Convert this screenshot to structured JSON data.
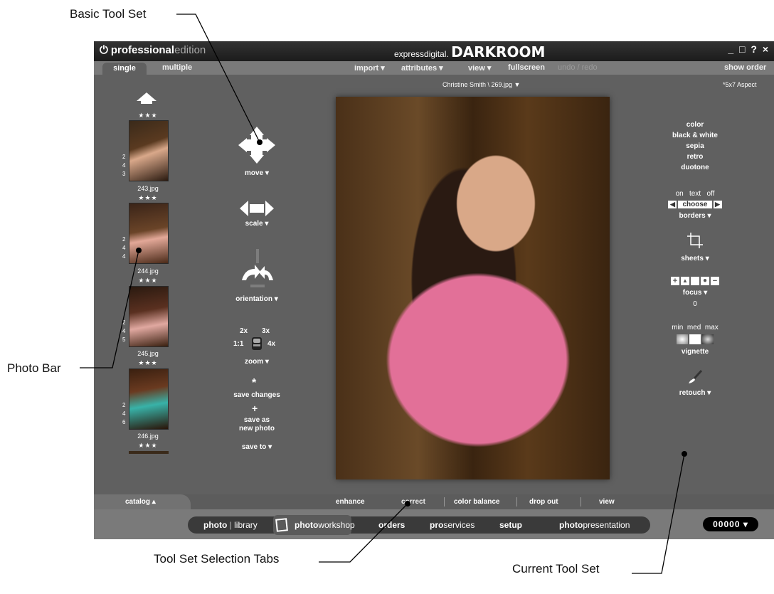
{
  "callouts": {
    "basic_tool_set": "Basic Tool Set",
    "photo_bar": "Photo Bar",
    "tool_set_tabs": "Tool Set Selection Tabs",
    "current_tool_set": "Current Tool Set"
  },
  "titlebar": {
    "brand_bold": "professional",
    "brand_light": "edition",
    "logo_small": "expressdigital.",
    "logo_big": "DARKROOM",
    "window_buttons": "_ □ ? ×"
  },
  "menubar": {
    "tab_single": "single",
    "tab_multiple": "multiple",
    "import": "import ▾",
    "attributes": "attributes ▾",
    "view": "view ▾",
    "fullscreen": "fullscreen",
    "undo_redo": "undo / redo",
    "show_order": "show order"
  },
  "caption": {
    "filename": "Christine Smith \\ 269.jpg ▼",
    "aspect": "*5x7 Aspect"
  },
  "photobar": {
    "stars": "★★★",
    "thumbs": [
      {
        "file": "243.jpg",
        "nums": [
          "2",
          "4",
          "3"
        ]
      },
      {
        "file": "244.jpg",
        "nums": [
          "2",
          "4",
          "4"
        ]
      },
      {
        "file": "245.jpg",
        "nums": [
          "2",
          "4",
          "5"
        ]
      },
      {
        "file": "246.jpg",
        "nums": [
          "2",
          "4",
          "6"
        ]
      }
    ]
  },
  "tools": {
    "move": "move ▾",
    "scale": "scale ▾",
    "orientation": "orientation ▾",
    "zoom_2x": "2x",
    "zoom_3x": "3x",
    "zoom_1to1": "1:1",
    "zoom_4x": "4x",
    "zoom": "zoom ▾",
    "save_changes": "save changes",
    "save_new_1": "save as",
    "save_new_2": "new photo",
    "save_to": "save to ▾"
  },
  "effects": {
    "color": "color",
    "bw": "black & white",
    "sepia": "sepia",
    "retro": "retro",
    "duotone": "duotone",
    "on": "on",
    "text": "text",
    "off": "off",
    "choose": "choose",
    "borders": "borders ▾",
    "sheets": "sheets ▾",
    "focus": "focus ▾",
    "focus_value": "0",
    "min": "min",
    "med": "med",
    "max": "max",
    "vignette": "vignette",
    "retouch": "retouch ▾"
  },
  "subtabs": {
    "catalog": "catalog ▴",
    "enhance": "enhance",
    "correct": "correct",
    "color_balance": "color balance",
    "drop_out": "drop out",
    "view": "view"
  },
  "nav": {
    "photo_library_a": "photo",
    "photo_library_b": "library",
    "photo_workshop_a": "photo",
    "photo_workshop_b": "workshop",
    "orders": "orders",
    "pro_services_a": "pro",
    "pro_services_b": "services",
    "setup": "setup",
    "photo_presentation_a": "photo",
    "photo_presentation_b": "presentation",
    "counter": "00000 ▾"
  }
}
